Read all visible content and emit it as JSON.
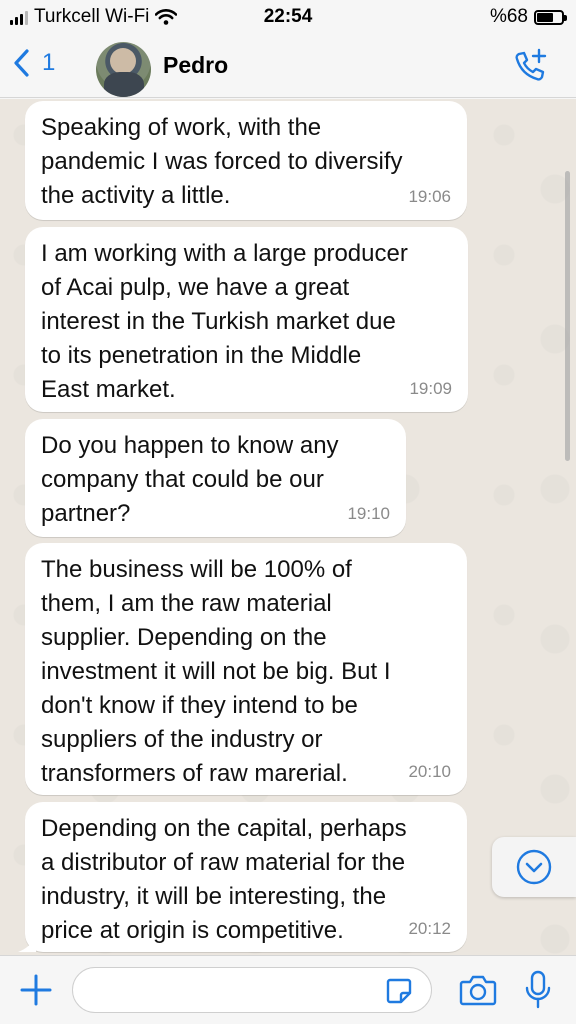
{
  "status_bar": {
    "carrier": "Turkcell Wi-Fi",
    "time": "22:54",
    "battery": "%68",
    "battery_level": 0.68
  },
  "header": {
    "back_count": "1",
    "contact_name": "Pedro",
    "icons": {
      "back": "chevron-left-icon",
      "call": "phone-add-icon"
    }
  },
  "messages": [
    {
      "text": "Speaking of work, with the\npandemic I was forced to diversify\nthe activity a little.",
      "time": "19:06"
    },
    {
      "text": "I am working with a large producer\nof Acai pulp, we have a great\ninterest in the Turkish market due\nto its penetration in the Middle\nEast market.",
      "time": "19:09"
    },
    {
      "text": "Do you happen to know any\ncompany that could be our\npartner?",
      "time": "19:10"
    },
    {
      "text": "The business will be 100% of\nthem, I am the raw material\nsupplier. Depending on the\ninvestment it will not be big. But I\ndon't know if they intend to be\nsuppliers of the industry or\ntransformers of raw marerial.",
      "time": "20:10"
    },
    {
      "text": "Depending on the capital, perhaps\na distributor of raw material for the\nindustry, it will be interesting, the\nprice at origin is competitive.",
      "time": "20:12"
    }
  ],
  "composer": {
    "input_value": "",
    "input_placeholder": "",
    "icons": [
      "plus-icon",
      "sticker-icon",
      "camera-icon",
      "microphone-icon"
    ]
  },
  "colors": {
    "accent": "#1f7ae0",
    "bubble": "#ffffff",
    "chat_bg": "#ebe6df"
  }
}
